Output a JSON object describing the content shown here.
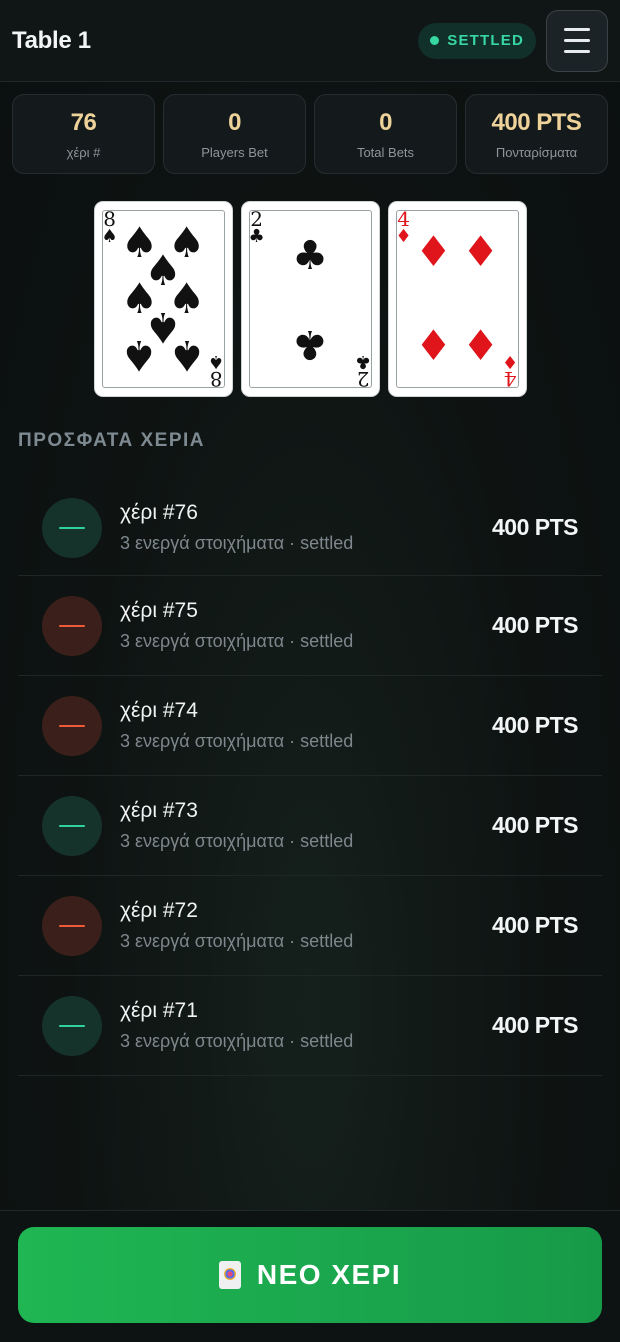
{
  "header": {
    "title": "Table 1",
    "status": "SETTLED"
  },
  "stats": [
    {
      "value": "76",
      "label": "χέρι #"
    },
    {
      "value": "0",
      "label": "Players Bet"
    },
    {
      "value": "0",
      "label": "Total Bets"
    },
    {
      "value": "400 PTS",
      "label": "Πονταρίσματα"
    }
  ],
  "cards": [
    {
      "rank": "8",
      "suit": "♠",
      "color": "#111111"
    },
    {
      "rank": "2",
      "suit": "♣",
      "color": "#111111"
    },
    {
      "rank": "4",
      "suit": "♦",
      "color": "#e0141b"
    }
  ],
  "recent": {
    "title": "ΠΡΟΣΦΑΤΑ ΧΕΡΙΑ",
    "hands": [
      {
        "name": "χέρι #76",
        "sub": "3 ενεργά στοιχήματα · settled",
        "amount": "400 PTS",
        "result": "win"
      },
      {
        "name": "χέρι #75",
        "sub": "3 ενεργά στοιχήματα · settled",
        "amount": "400 PTS",
        "result": "loss"
      },
      {
        "name": "χέρι #74",
        "sub": "3 ενεργά στοιχήματα · settled",
        "amount": "400 PTS",
        "result": "loss"
      },
      {
        "name": "χέρι #73",
        "sub": "3 ενεργά στοιχήματα · settled",
        "amount": "400 PTS",
        "result": "win"
      },
      {
        "name": "χέρι #72",
        "sub": "3 ενεργά στοιχήματα · settled",
        "amount": "400 PTS",
        "result": "loss"
      },
      {
        "name": "χέρι #71",
        "sub": "3 ενεργά στοιχήματα · settled",
        "amount": "400 PTS",
        "result": "win"
      }
    ]
  },
  "footer": {
    "button_label": "ΝΕΟ ΧΕΡΙ",
    "button_icon": "joker-card-icon"
  },
  "colors": {
    "accent": "#1fb653",
    "win": "#2fd39a",
    "loss": "#ef5a3c",
    "stat_value": "#eed29a"
  }
}
